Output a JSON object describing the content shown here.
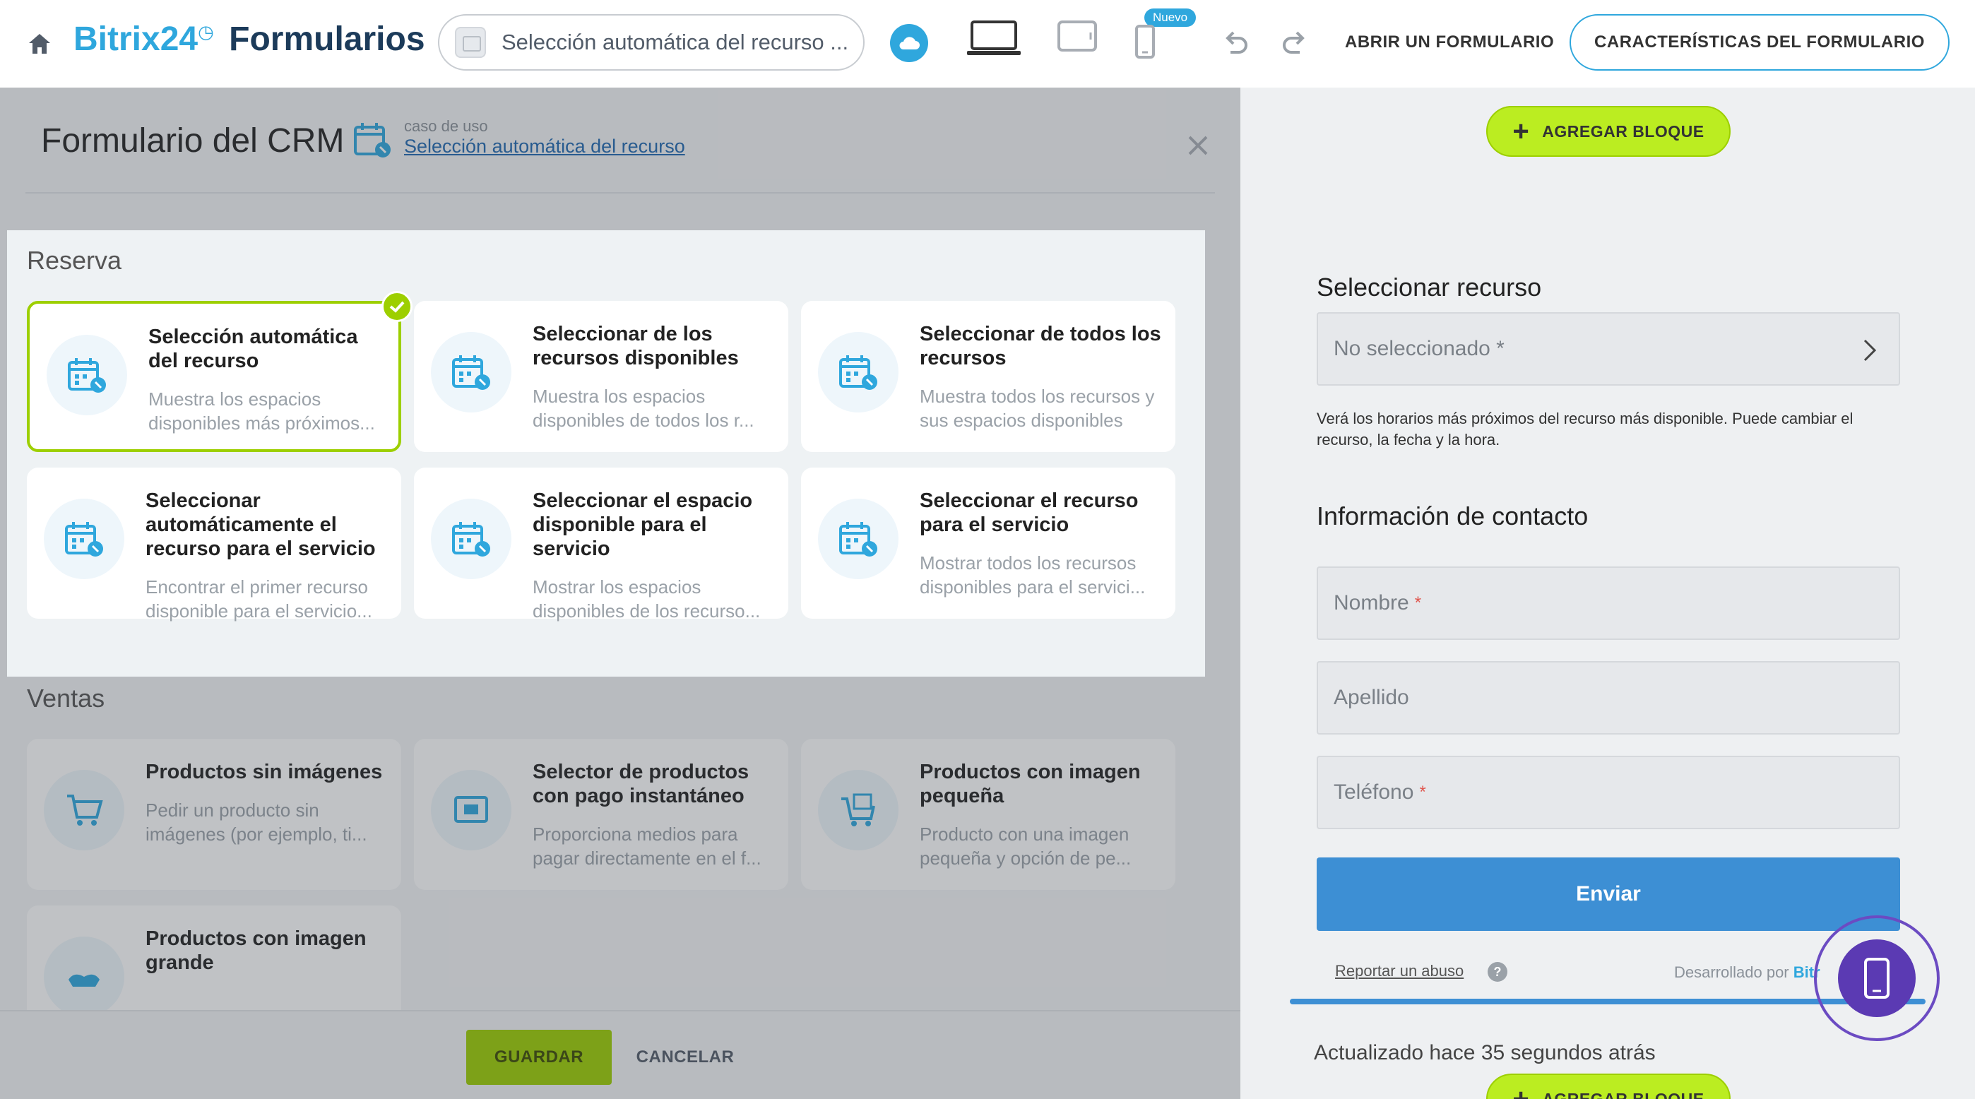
{
  "topbar": {
    "brand_name": "Bitrix24",
    "brand_product": "Formularios",
    "usecase_value": "Selección automática del recurso ...",
    "new_badge": "Nuevo",
    "open_form_label": "ABRIR UN FORMULARIO",
    "features_label": "CARACTERÍSTICAS DEL FORMULARIO"
  },
  "panel": {
    "title": "Formulario del CRM",
    "usecase_caption": "caso de uso",
    "usecase_link": "Selección automática del recurso"
  },
  "sections": [
    {
      "title": "Reserva",
      "cards": [
        {
          "title": "Selección automática del recurso",
          "desc": "Muestra los espacios disponibles más próximos...",
          "selected": true
        },
        {
          "title": "Seleccionar de los recursos disponibles",
          "desc": "Muestra los espacios disponibles de todos los r..."
        },
        {
          "title": "Seleccionar de todos los recursos",
          "desc": "Muestra todos los recursos y sus espacios disponibles"
        },
        {
          "title": "Seleccionar automáticamente el recurso para el servicio",
          "desc": "Encontrar el primer recurso disponible para el servicio..."
        },
        {
          "title": "Seleccionar el espacio disponible para el servicio",
          "desc": "Mostrar los espacios disponibles de los recurso..."
        },
        {
          "title": "Seleccionar el recurso para el servicio",
          "desc": "Mostrar todos los recursos disponibles para el servici..."
        }
      ]
    },
    {
      "title": "Ventas",
      "cards": [
        {
          "title": "Productos sin imágenes",
          "desc": "Pedir un producto sin imágenes (por ejemplo, ti..."
        },
        {
          "title": "Selector de productos con pago instantáneo",
          "desc": "Proporciona medios para pagar directamente en el f..."
        },
        {
          "title": "Productos con imagen pequeña",
          "desc": "Producto con una imagen pequeña y opción de pe..."
        },
        {
          "title": "Productos con imagen grande",
          "desc": ""
        }
      ]
    }
  ],
  "footer": {
    "save_label": "GUARDAR",
    "cancel_label": "CANCELAR"
  },
  "preview": {
    "add_block_label": "AGREGAR BLOQUE",
    "resource_title": "Seleccionar recurso",
    "resource_value": "No seleccionado *",
    "resource_help": "Verá los horarios más próximos del recurso más disponible. Puede cambiar el recurso, la fecha y la hora.",
    "contact_title": "Información de contacto",
    "fields": [
      {
        "label": "Nombre",
        "required": "*"
      },
      {
        "label": "Apellido",
        "required": ""
      },
      {
        "label": "Teléfono",
        "required": "*"
      }
    ],
    "send_label": "Enviar",
    "report_label": "Reportar un abuso",
    "help_icon": "?",
    "powered_by": "Desarrollado por",
    "powered_brand": "Bitr",
    "updated_text": "Actualizado hace 35 segundos atrás"
  },
  "colors": {
    "accent": "#2fa7dd",
    "green": "#9dcf00",
    "send": "#3d8fd4",
    "fab": "#5b3ab3"
  }
}
